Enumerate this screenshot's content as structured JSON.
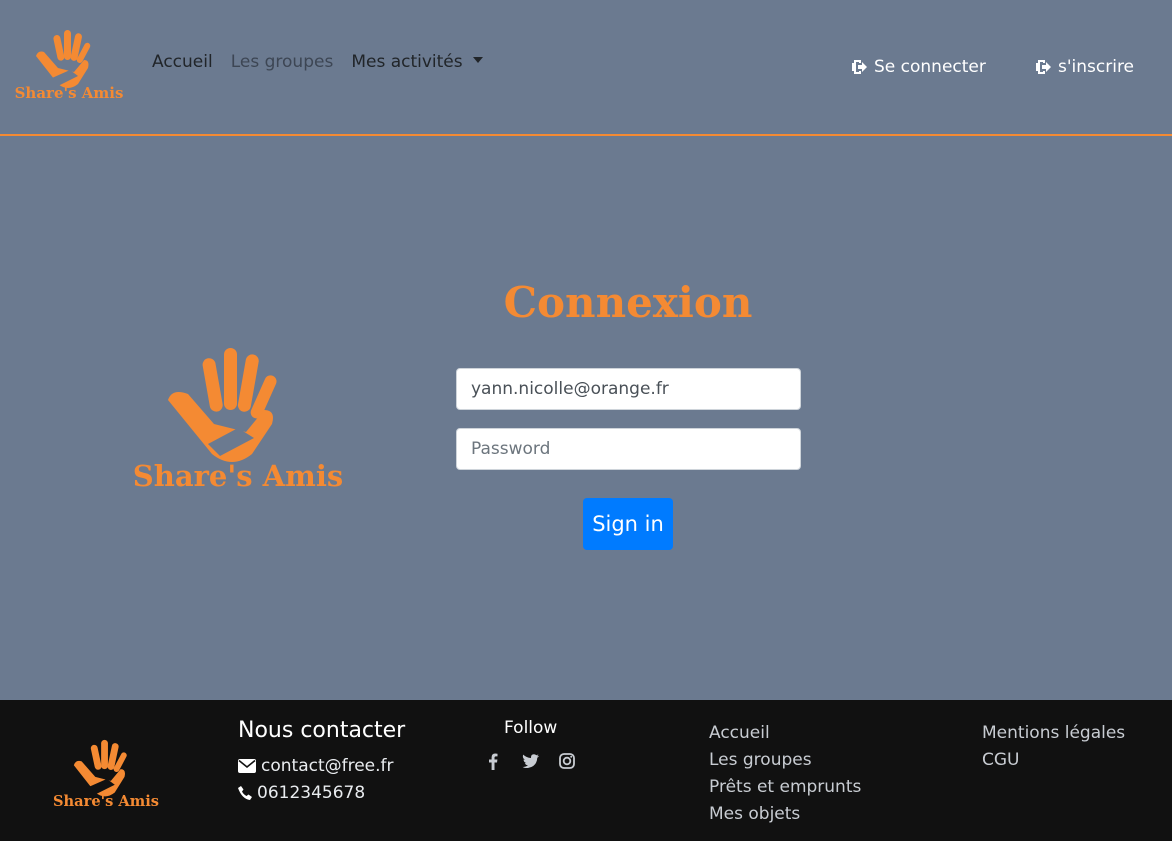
{
  "brand": {
    "name": "Share's Amis",
    "accent": "#f48a33"
  },
  "nav": {
    "items": [
      {
        "label": "Accueil"
      },
      {
        "label": "Les groupes"
      },
      {
        "label": "Mes activités"
      }
    ],
    "login": "Se connecter",
    "signup": "s'inscrire"
  },
  "login": {
    "title": "Connexion",
    "email_value": "yann.nicolle@orange.fr",
    "password_placeholder": "Password",
    "submit": "Sign in"
  },
  "footer": {
    "contact_title": "Nous contacter",
    "email": "contact@free.fr",
    "phone": "0612345678",
    "follow": "Follow",
    "social_icons": [
      "facebook-icon",
      "twitter-icon",
      "instagram-icon"
    ],
    "links_1": [
      {
        "label": "Accueil"
      },
      {
        "label": "Les groupes"
      },
      {
        "label": "Prêts et emprunts"
      },
      {
        "label": "Mes objets"
      }
    ],
    "links_2": [
      {
        "label": "Mentions légales"
      },
      {
        "label": "CGU"
      }
    ]
  },
  "colors": {
    "background": "#6b7a90",
    "primary_button": "#007bff",
    "footer": "#111111"
  }
}
